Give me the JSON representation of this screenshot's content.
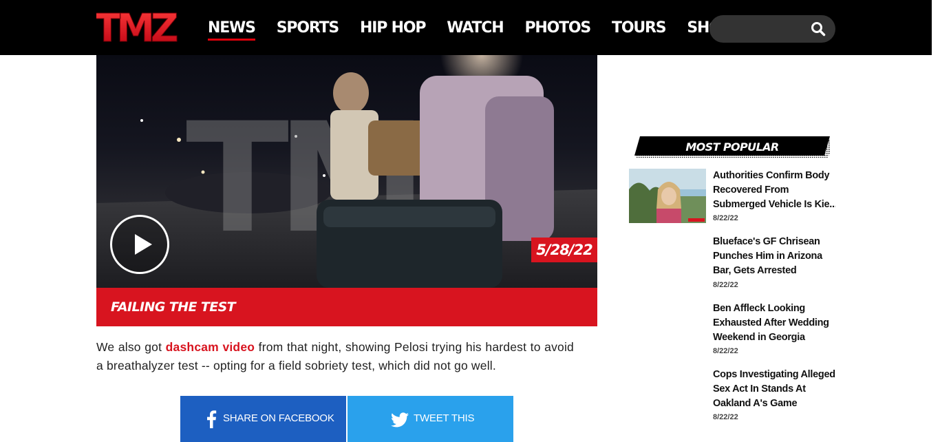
{
  "header": {
    "logo_text": "TMZ",
    "nav": [
      "NEWS",
      "SPORTS",
      "HIP HOP",
      "WATCH",
      "PHOTOS",
      "TOURS",
      "SHOP"
    ],
    "search_value": "",
    "search_placeholder": ""
  },
  "video": {
    "date": "5/28/22",
    "caption": "FAILING THE TEST",
    "watermark": "TMZ"
  },
  "article": {
    "text_before": "We also got ",
    "link_text": "dashcam video",
    "text_after": " from that night, showing Pelosi trying his hardest to avoid a breathalyzer test -- opting for a field sobriety test, which did not go well."
  },
  "share": {
    "facebook": "SHARE ON FACEBOOK",
    "twitter": "TWEET THIS"
  },
  "sidebar": {
    "title": "MOST POPULAR",
    "items": [
      {
        "lines": [
          "Authorities Confirm Body",
          "Recovered From",
          "Submerged Vehicle Is Kie..."
        ],
        "date": "8/22/22"
      },
      {
        "lines": [
          "Blueface's GF Chrisean",
          "Punches Him in Arizona",
          "Bar, Gets Arrested"
        ],
        "date": "8/22/22"
      },
      {
        "lines": [
          "Ben Affleck Looking",
          "Exhausted After Wedding",
          "Weekend in Georgia"
        ],
        "date": "8/22/22"
      },
      {
        "lines": [
          "Cops Investigating Alleged",
          "Sex Act In Stands At",
          "Oakland A's Game"
        ],
        "date": "8/22/22"
      }
    ]
  },
  "colors": {
    "brand_red": "#d8141f",
    "header_bg": "#000000",
    "facebook_blue": "#1d5fc1",
    "twitter_blue": "#2aa1ec"
  },
  "icons": [
    "search-icon",
    "play-icon",
    "facebook-icon",
    "twitter-icon"
  ]
}
